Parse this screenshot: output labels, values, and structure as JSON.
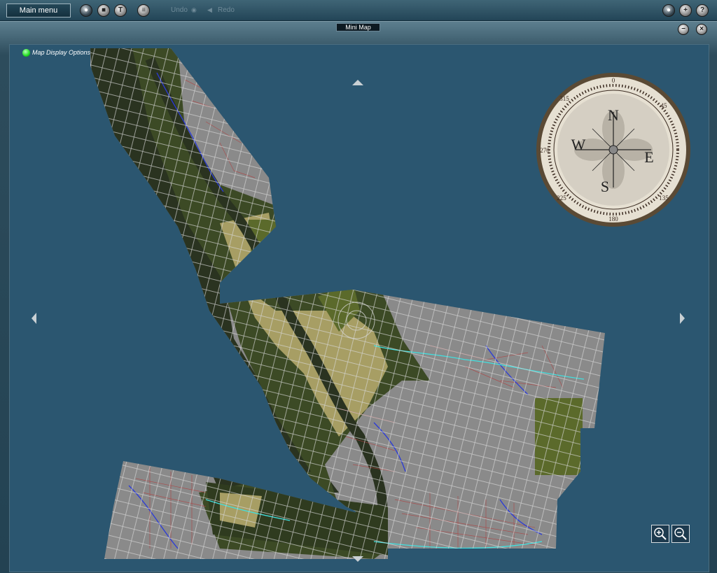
{
  "toolbar": {
    "main_menu_label": "Main menu",
    "undo_label": "Undo",
    "redo_label": "Redo",
    "left_icons": [
      "globe-icon",
      "stop-icon",
      "tools-icon",
      "layers-icon"
    ],
    "right_icons": [
      "sphere-icon",
      "add-icon",
      "help-icon"
    ]
  },
  "window": {
    "title": "Mini Map"
  },
  "map": {
    "display_options_label": "Map Display Options",
    "colors": {
      "water": "#2b5670",
      "tile_urban": "#8a8a8a",
      "tile_forest_dark": "#2a3320",
      "tile_forest": "#3c4a25",
      "tile_field": "#a79e64",
      "tile_grass": "#5b6a2b",
      "roads": "#b04040",
      "rivers": "#2a3ad8",
      "rail": "#40e0e0"
    }
  },
  "compass": {
    "letters": [
      "N",
      "E",
      "S",
      "W"
    ],
    "degrees": [
      "0",
      "45",
      "135",
      "180",
      "225",
      "270",
      "315"
    ]
  },
  "zoom": {
    "in_icon": "zoom-in-icon",
    "out_icon": "zoom-out-icon"
  }
}
